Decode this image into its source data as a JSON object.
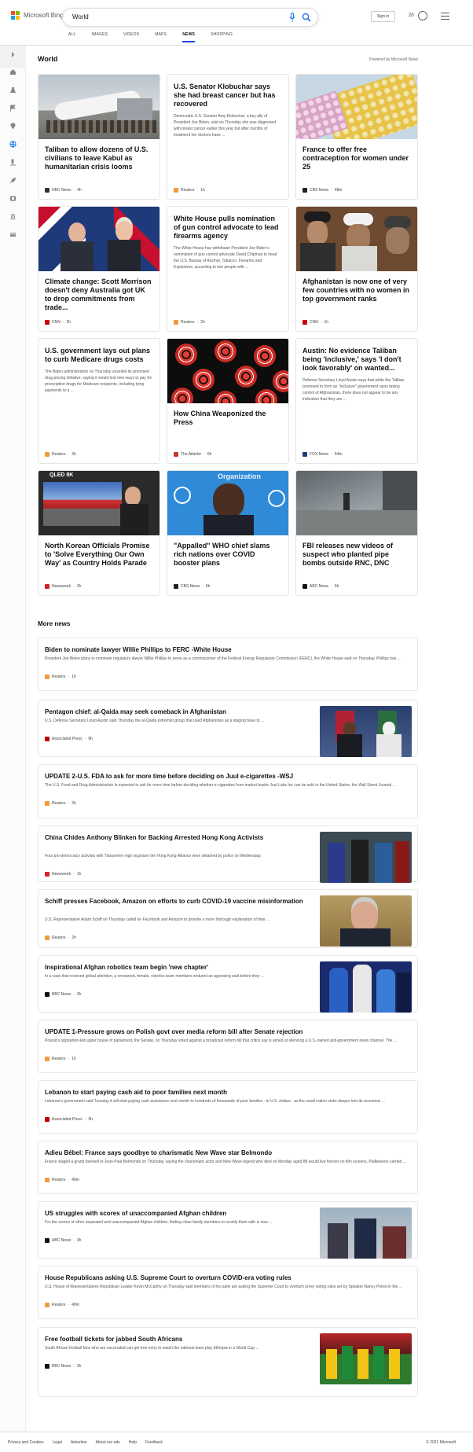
{
  "header": {
    "brand": "Microsoft Bing",
    "query": "World",
    "signin_label": "Sign in",
    "points": "20",
    "colors": {
      "accent": "#174ae4",
      "mic": "#1a73e8"
    },
    "tabs": [
      "ALL",
      "IMAGES",
      "VIDEOS",
      "MAPS",
      "NEWS",
      "SHOPPING"
    ],
    "active_tab": "NEWS"
  },
  "rail_icons": [
    "chevron-right-icon",
    "home-icon",
    "flask-icon",
    "flag-icon",
    "location-icon",
    "globe-icon",
    "microscope-icon",
    "rocket-icon",
    "film-icon",
    "bank-icon",
    "card-icon"
  ],
  "section": {
    "title": "World",
    "powered": "Powered by Microsoft News"
  },
  "cards": [
    {
      "title": "Taliban to allow dozens of U.S. civilians to leave Kabul as humanitarian crisis looms",
      "snippet": "",
      "source": "NBC News",
      "time": "4h",
      "src_color": "#333333",
      "image": "plane-photo"
    },
    {
      "title": "U.S. Senator Klobuchar says she had breast cancer but has recovered",
      "snippet": "Democratic U.S. Senator Amy Klobuchar, a key ally of President Joe Biden, said on Thursday she was diagnosed with breast cancer earlier this year but after months of treatment her doctors have ...",
      "source": "Reuters",
      "time": "1h",
      "src_color": "#f29a3a",
      "image": ""
    },
    {
      "title": "France to offer free contraception for women under 25",
      "snippet": "",
      "source": "CBS News",
      "time": "48m",
      "src_color": "#222222",
      "image": "pills-photo"
    },
    {
      "title": "Climate change: Scott Morrison doesn't deny Australia got UK to drop commitments from trade...",
      "snippet": "",
      "source": "CNN",
      "time": "2h",
      "src_color": "#cc0000",
      "image": "leaders-photo"
    },
    {
      "title": "White House pulls nomination of gun control advocate to lead firearms agency",
      "snippet": "The White House has withdrawn President Joe Biden's nomination of gun control advocate David Chipman to head the U.S. Bureau of Alcohol, Tobacco, Firearms and Explosives, according to two people with ...",
      "source": "Reuters",
      "time": "2h",
      "src_color": "#f29a3a",
      "image": ""
    },
    {
      "title": "Afghanistan is now one of very few countries with no women in top government ranks",
      "snippet": "",
      "source": "CNN",
      "time": "1h",
      "src_color": "#cc0000",
      "image": "taliban-photo"
    },
    {
      "title": "U.S. government lays out plans to curb Medicare drugs costs",
      "snippet": "The Biden administration on Thursday unveiled its promised drug pricing initiative, saying it would test new ways to pay for prescription drugs for Medicare recipients, including tying payments to a ...",
      "source": "Reuters",
      "time": "3h",
      "src_color": "#f29a3a",
      "image": ""
    },
    {
      "title": "How China Weaponized the Press",
      "snippet": "",
      "source": "The Atlantic",
      "time": "6h",
      "src_color": "#c0392b",
      "image": "circles-art"
    },
    {
      "title": "Austin: No evidence Taliban being 'inclusive,' says 'I don't look favorably' on wanted...",
      "snippet": "Defense Secretary Lloyd Austin says that while the Taliban promised to form an \"inclusive\" government upon taking control of Afghanistan, there does not appear to be any indication that they are ...",
      "source": "FOX News",
      "time": "54m",
      "src_color": "#1d3b7a",
      "image": ""
    },
    {
      "title": "North Korean Officials Promise to 'Solve Everything Our Own Way' as Country Holds Parade",
      "snippet": "",
      "source": "Newsweek",
      "time": "2h",
      "src_color": "#d81e2b",
      "image": "tv-photo"
    },
    {
      "title": "\"Appalled\" WHO chief slams rich nations over COVID booster plans",
      "snippet": "",
      "source": "CBS News",
      "time": "6h",
      "src_color": "#222222",
      "image": "who-photo"
    },
    {
      "title": "FBI releases new videos of suspect who planted pipe bombs outside RNC, DNC",
      "snippet": "",
      "source": "ABC News",
      "time": "6h",
      "src_color": "#111111",
      "image": "cctv-photo"
    }
  ],
  "card_image_text": {
    "tv": "QLED 8K",
    "who": "Organization"
  },
  "more_news_title": "More news",
  "more_news": [
    {
      "title": "Biden to nominate lawyer Willie Phillips to FERC -White House",
      "snippet": "President Joe Biden plans to nominate regulatory lawyer Willie Phillips to serve as a commissioner of the Federal Energy Regulatory Commission (FERC), the White House said on Thursday. Phillips has ...",
      "source": "Reuters",
      "time": "1h",
      "src_color": "#f29a3a",
      "thumb": ""
    },
    {
      "title": "Pentagon chief: al-Qaida may seek comeback in Afghanistan",
      "snippet": "U.S. Defense Secretary Lloyd Austin said Thursday the al-Qaida extremist group that used Afghanistan as a staging base to ...",
      "source": "Associated Press",
      "time": "9h",
      "src_color": "#c00000",
      "thumb": "podium-photo"
    },
    {
      "title": "UPDATE 2-U.S. FDA to ask for more time before deciding on Juul e-cigarettes -WSJ",
      "snippet": "The U.S. Food and Drug Administration is expected to ask for more time before deciding whether e-cigarettes from market leader Juul Labs Inc can be sold in the United States, the Wall Street Journal ...",
      "source": "Reuters",
      "time": "2h",
      "src_color": "#f29a3a",
      "thumb": ""
    },
    {
      "title": "China Chides Anthony Blinken for Backing Arrested Hong Kong Activists",
      "snippet": "Four pro-democracy activists with Tiananmen vigil organizer the Hong Kong Alliance were detained by police on Wednesday.",
      "source": "Newsweek",
      "time": "1h",
      "src_color": "#d81e2b",
      "thumb": "police-photo"
    },
    {
      "title": "Schiff presses Facebook, Amazon on efforts to curb COVID-19 vaccine misinformation",
      "snippet": "U.S. Representative Adam Schiff on Thursday called on Facebook and Amazon to provide a more thorough explanation of their ...",
      "source": "Reuters",
      "time": "2h",
      "src_color": "#f29a3a",
      "thumb": "schiff-photo"
    },
    {
      "title": "Inspirational Afghan robotics team begin 'new chapter'",
      "snippet": "In a case that received global attention, a renowned, female, robotics team members endured an agonising wait before they ...",
      "source": "BBC News",
      "time": "2h",
      "src_color": "#111111",
      "thumb": "robotics-photo"
    },
    {
      "title": "UPDATE 1-Pressure grows on Polish govt over media reform bill after Senate rejection",
      "snippet": "Poland's opposition-led upper house of parliament, the Senate, on Thursday voted against a broadcast reform bill that critics say is aimed at silencing a U.S.-owned anti-government news channel. The ...",
      "source": "Reuters",
      "time": "1h",
      "src_color": "#f29a3a",
      "thumb": ""
    },
    {
      "title": "Lebanon to start paying cash aid to poor families next month",
      "snippet": "Lebanon's government said Tuesday it will start paying cash assistance next month to hundreds of thousands of poor families - in U.S. dollars - as the small nation sinks deeper into its economic ...",
      "source": "Associated Press",
      "time": "3h",
      "src_color": "#c00000",
      "thumb": ""
    },
    {
      "title": "Adieu Bébel: France says goodbye to charismatic New Wave star Belmondo",
      "snippet": "France staged a grand farewell to Jean-Paul Belmondo on Thursday, saying the charismatic actor and New Wave legend who died on Monday aged 88 would live forever on film screens. Pallbearers carried ...",
      "source": "Reuters",
      "time": "49m",
      "src_color": "#f29a3a",
      "thumb": ""
    },
    {
      "title": "US struggles with scores of unaccompanied Afghan children",
      "snippet": "For the scores of other separated and unaccompanied Afghan children, finding close family members to reunify them with is now ...",
      "source": "ABC News",
      "time": "3h",
      "src_color": "#111111",
      "thumb": "children-photo"
    },
    {
      "title": "House Republicans asking U.S. Supreme Court to overturn COVID-era voting rules",
      "snippet": "U.S. House of Representatives Republican Leader Kevin McCarthy on Thursday said members of his party are asking the Supreme Court to overturn proxy voting rules set by Speaker Nancy Pelosi in the ...",
      "source": "Reuters",
      "time": "40m",
      "src_color": "#f29a3a",
      "thumb": ""
    },
    {
      "title": "Free football tickets for jabbed South Africans",
      "snippet": "South African football fans who are vaccinated can get free entry to watch the national team play Ethiopia in a World Cup ...",
      "source": "BBC News",
      "time": "3h",
      "src_color": "#111111",
      "thumb": "football-photo"
    }
  ],
  "footer": {
    "links": [
      "Privacy and Cookies",
      "Legal",
      "Advertise",
      "About our ads",
      "Help",
      "Feedback"
    ],
    "copyright": "© 2021 Microsoft"
  }
}
